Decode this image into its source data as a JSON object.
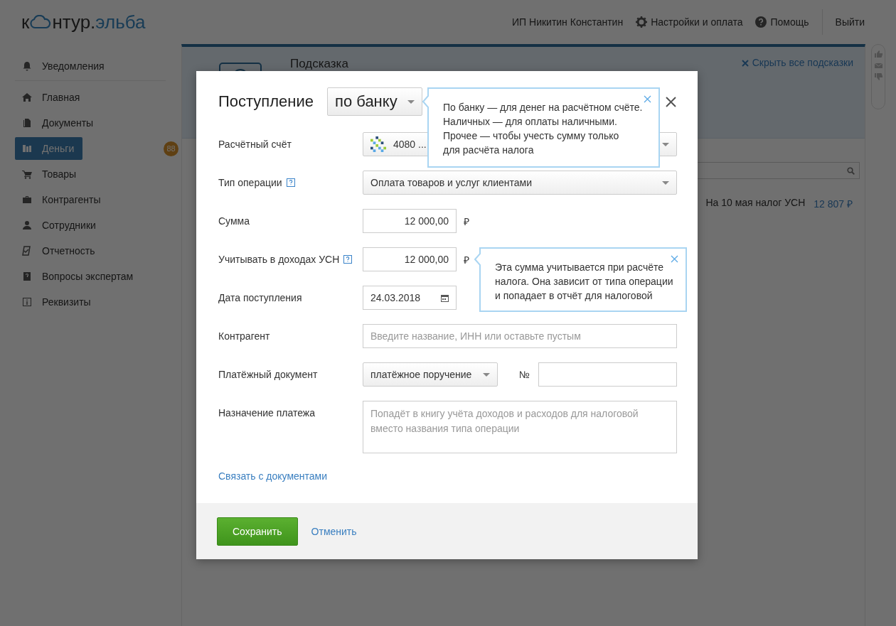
{
  "header": {
    "logo": {
      "part_1": "к",
      "part_2": "нтур.",
      "part_3": "эльба"
    },
    "links": [
      {
        "kind": "text",
        "label": "ИП Никитин Константин"
      },
      {
        "kind": "gear",
        "label": "Настройки и оплата"
      },
      {
        "kind": "help",
        "label": "Помощь"
      },
      {
        "kind": "logout",
        "label": "Выйти"
      }
    ]
  },
  "sidebar": {
    "items": [
      {
        "kind": "bell",
        "label": "Уведомления",
        "selected": false
      },
      {
        "kind": "home",
        "label": "Главная",
        "selected": false
      },
      {
        "kind": "docs",
        "label": "Документы",
        "selected": false
      },
      {
        "kind": "money",
        "label": "Деньги",
        "selected": true,
        "badge": "88"
      },
      {
        "kind": "cart",
        "label": "Товары",
        "selected": false
      },
      {
        "kind": "case",
        "label": "Контрагенты",
        "selected": false
      },
      {
        "kind": "person",
        "label": "Сотрудники",
        "selected": false
      },
      {
        "kind": "report",
        "label": "Отчетность",
        "selected": false
      },
      {
        "kind": "question",
        "label": "Вопросы экспертам",
        "selected": false
      },
      {
        "kind": "info",
        "label": "Реквизиты",
        "selected": false
      }
    ]
  },
  "hint_panel": {
    "title": "Подсказка",
    "hide_link": "Скрыть все подсказки"
  },
  "tax_summary": {
    "label": "На 10 мая налог УСН",
    "amount": "12 807 ₽"
  },
  "modal": {
    "title": "Поступление",
    "type_select": "по банку",
    "fields": [
      {
        "kind": "account",
        "label": "Расчётный счёт",
        "help": false,
        "value": "4080 ..."
      },
      {
        "kind": "select",
        "label": "Тип операции",
        "help": true,
        "value": "Оплата товаров и услуг клиентами"
      },
      {
        "kind": "amount",
        "label": "Сумма",
        "help": false,
        "value": "12 000,00",
        "currency": "₽"
      },
      {
        "kind": "amount",
        "label": "Учитывать в доходах УСН",
        "help": true,
        "value": "12 000,00",
        "currency": "₽"
      },
      {
        "kind": "date",
        "label": "Дата поступления",
        "help": false,
        "value": "24.03.2018"
      },
      {
        "kind": "text",
        "label": "Контрагент",
        "help": false,
        "placeholder": "Введите название, ИНН или оставьте пустым"
      },
      {
        "kind": "document",
        "label": "Платёжный документ",
        "help": false,
        "value": "платёжное поручение",
        "number_label": "№"
      },
      {
        "kind": "textarea",
        "label": "Назначение платежа",
        "help": false,
        "placeholder": "Попадёт в книгу учёта доходов и расходов для налоговой вместо названия типа операции"
      }
    ],
    "link": "Связать с документами",
    "save_button": "Сохранить",
    "cancel_link": "Отменить"
  },
  "tooltips": [
    {
      "lines": [
        "По банку — для денег на расчётном счёте.",
        "Наличных — для оплаты наличными.",
        "Прочее — чтобы учесть сумму только",
        "для расчёта налога"
      ]
    },
    {
      "lines": [
        "Эта сумма учитывается при расчёте",
        "налога. Она зависит от типа операции",
        "и попадает в отчёт для налоговой"
      ]
    }
  ]
}
